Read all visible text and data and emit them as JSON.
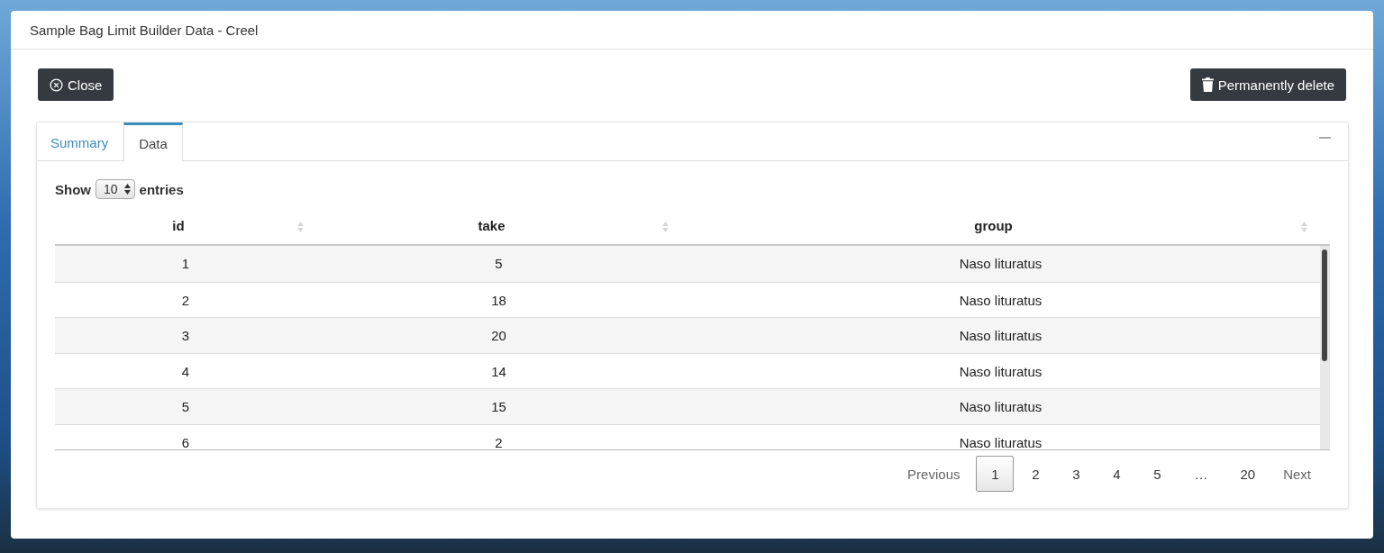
{
  "window": {
    "title": "Sample Bag Limit Builder Data - Creel"
  },
  "buttons": [
    {
      "kind": "close",
      "label": "Close"
    },
    {
      "kind": "delete",
      "label": "Permanently delete"
    }
  ],
  "tabs": [
    {
      "label": "Summary",
      "selected": false
    },
    {
      "label": "Data",
      "selected": true
    }
  ],
  "length_menu": {
    "prefix": "Show",
    "value": "10",
    "suffix": "entries"
  },
  "table": {
    "columns": [
      "id",
      "take",
      "group"
    ],
    "rows": [
      [
        "1",
        "5",
        "Naso lituratus"
      ],
      [
        "2",
        "18",
        "Naso lituratus"
      ],
      [
        "3",
        "20",
        "Naso lituratus"
      ],
      [
        "4",
        "14",
        "Naso lituratus"
      ],
      [
        "5",
        "15",
        "Naso lituratus"
      ],
      [
        "6",
        "2",
        "Naso lituratus"
      ]
    ]
  },
  "pagination": {
    "previous": "Previous",
    "next": "Next",
    "pages": [
      {
        "kind": "page",
        "label": "1",
        "selected": true
      },
      {
        "kind": "page",
        "label": "2",
        "selected": false
      },
      {
        "kind": "page",
        "label": "3",
        "selected": false
      },
      {
        "kind": "page",
        "label": "4",
        "selected": false
      },
      {
        "kind": "page",
        "label": "5",
        "selected": false
      },
      {
        "kind": "ellipsis",
        "label": "…"
      },
      {
        "kind": "page",
        "label": "20",
        "selected": false
      }
    ]
  }
}
